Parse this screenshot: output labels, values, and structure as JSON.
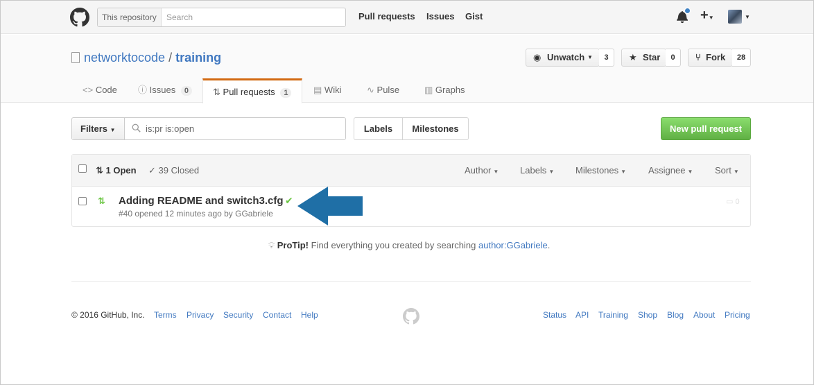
{
  "header": {
    "search_scope": "This repository",
    "search_placeholder": "Search",
    "nav": [
      "Pull requests",
      "Issues",
      "Gist"
    ]
  },
  "repo": {
    "owner": "networktocode",
    "separator": "/",
    "name": "training",
    "unwatch_label": "Unwatch",
    "watch_count": "3",
    "star_label": "Star",
    "star_count": "0",
    "fork_label": "Fork",
    "fork_count": "28"
  },
  "tabs": [
    {
      "label": "Code",
      "icon": "code-icon"
    },
    {
      "label": "Issues",
      "icon": "issue-opened-icon",
      "count": "0"
    },
    {
      "label": "Pull requests",
      "icon": "git-pull-request-icon",
      "count": "1",
      "selected": true
    },
    {
      "label": "Wiki",
      "icon": "book-icon"
    },
    {
      "label": "Pulse",
      "icon": "pulse-icon"
    },
    {
      "label": "Graphs",
      "icon": "graph-icon"
    }
  ],
  "filters": {
    "button_label": "Filters",
    "query": "is:pr is:open",
    "labels_label": "Labels",
    "milestones_label": "Milestones",
    "new_pr_label": "New pull request"
  },
  "list": {
    "open_label": "1 Open",
    "closed_label": "39 Closed",
    "sort_options": [
      "Author",
      "Labels",
      "Milestones",
      "Assignee",
      "Sort"
    ],
    "items": [
      {
        "title": "Adding README and switch3.cfg",
        "meta": "#40 opened 12 minutes ago by GGabriele",
        "comments": "0",
        "status": "success"
      }
    ]
  },
  "protip": {
    "label": "ProTip!",
    "text": "Find everything you created by searching",
    "link": "author:GGabriele",
    "end": "."
  },
  "footer": {
    "copyright": "© 2016 GitHub, Inc.",
    "left_links": [
      "Terms",
      "Privacy",
      "Security",
      "Contact",
      "Help"
    ],
    "right_links": [
      "Status",
      "API",
      "Training",
      "Shop",
      "Blog",
      "About",
      "Pricing"
    ]
  },
  "colors": {
    "accent": "#4078c0",
    "green_button": "#60b044",
    "tab_highlight": "#d26911",
    "arrow": "#1f6fa6"
  }
}
